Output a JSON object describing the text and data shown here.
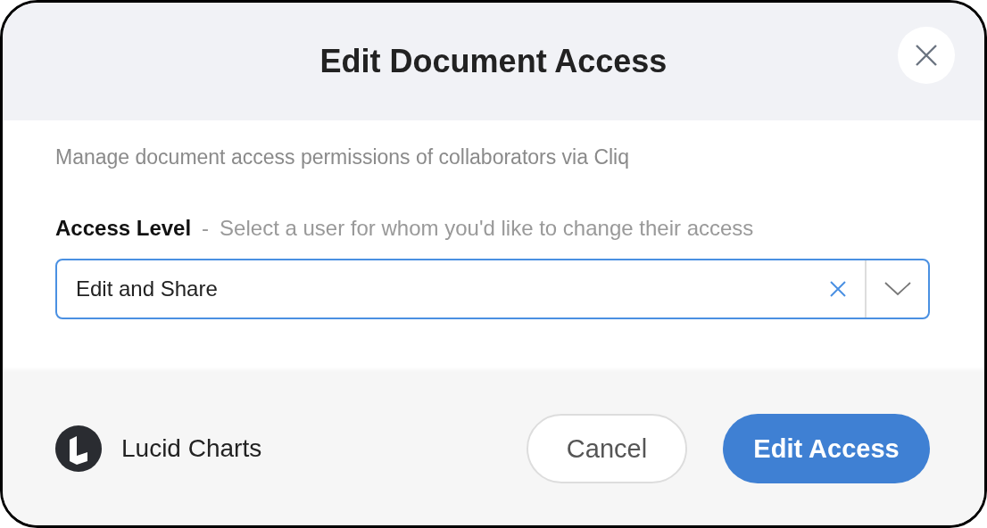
{
  "dialog": {
    "title": "Edit Document Access"
  },
  "description": "Manage document access permissions of collaborators via Cliq",
  "field": {
    "label": "Access Level",
    "separator": "-",
    "hint": "Select a user for whom you'd like to change their access",
    "value": "Edit and Share",
    "focused": true
  },
  "footer": {
    "app_name": "Lucid Charts",
    "buttons": [
      {
        "label": "Cancel",
        "kind": "secondary"
      },
      {
        "label": "Edit Access",
        "kind": "primary"
      }
    ]
  }
}
